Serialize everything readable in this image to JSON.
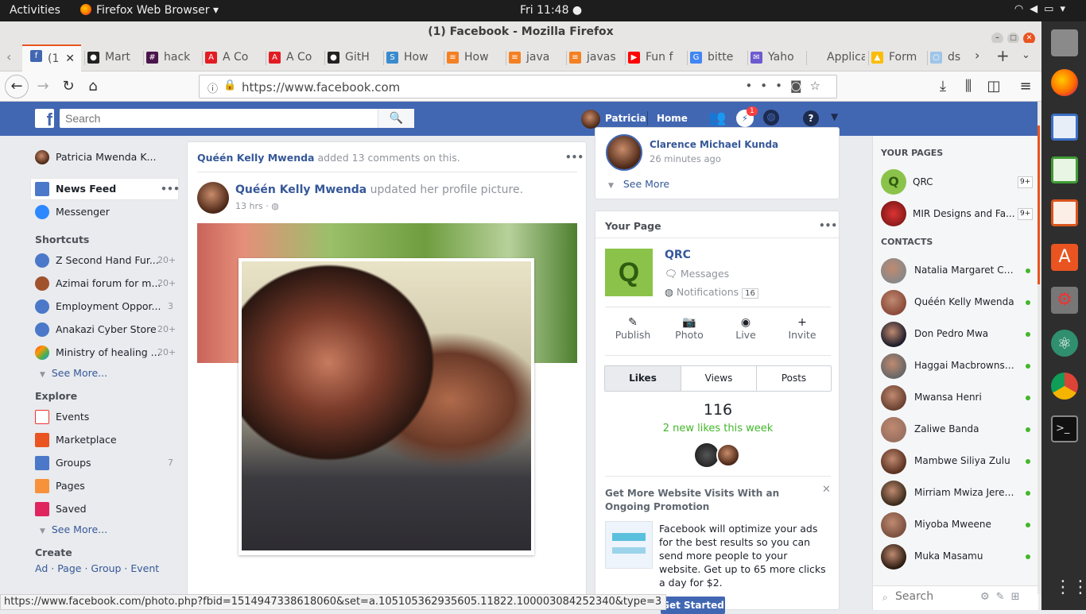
{
  "system": {
    "activities": "Activities",
    "app_name": "Firefox Web Browser",
    "clock": "Fri 11:48"
  },
  "window": {
    "title": "(1) Facebook - Mozilla Firefox"
  },
  "tabs": [
    {
      "label": "(1",
      "icon": "facebook-icon",
      "color": "#4267b2",
      "glyph": "f"
    },
    {
      "label": "Mart",
      "icon": "github-icon",
      "color": "#222222",
      "glyph": "●"
    },
    {
      "label": "hack",
      "icon": "slack-icon",
      "color": "#4a154b",
      "glyph": "#"
    },
    {
      "label": "A Co",
      "icon": "adobe-icon",
      "color": "#e31b23",
      "glyph": "A"
    },
    {
      "label": "A Co",
      "icon": "adobe-icon",
      "color": "#e31b23",
      "glyph": "A"
    },
    {
      "label": "GitH",
      "icon": "github-icon",
      "color": "#222222",
      "glyph": "●"
    },
    {
      "label": "How",
      "icon": "s-icon",
      "color": "#3b8bcc",
      "glyph": "S"
    },
    {
      "label": "How",
      "icon": "stackoverflow-icon",
      "color": "#f48024",
      "glyph": "≡"
    },
    {
      "label": "java",
      "icon": "stackoverflow-icon",
      "color": "#f48024",
      "glyph": "≡"
    },
    {
      "label": "javas",
      "icon": "stackoverflow-icon",
      "color": "#f48024",
      "glyph": "≡"
    },
    {
      "label": "Fun f",
      "icon": "youtube-icon",
      "color": "#ff0000",
      "glyph": "▶"
    },
    {
      "label": "bitte",
      "icon": "google-icon",
      "color": "#4285f4",
      "glyph": "G"
    },
    {
      "label": "Yaho",
      "icon": "mail-icon",
      "color": "#6d5bd0",
      "glyph": "✉"
    },
    {
      "label": "Applicat",
      "icon": "",
      "color": "",
      "glyph": ""
    },
    {
      "label": "Form",
      "icon": "drive-icon",
      "color": "#fbbc04",
      "glyph": "▲"
    },
    {
      "label": "ds",
      "icon": "bulb-icon",
      "color": "#9fc5e8",
      "glyph": "○"
    }
  ],
  "url": "https://www.facebook.com",
  "fb": {
    "search_placeholder": "Search",
    "user_first": "Patricia",
    "home": "Home",
    "msg_badge": "1"
  },
  "left": {
    "profile": "Patricia Mwenda K...",
    "news_feed": "News Feed",
    "messenger": "Messenger",
    "shortcuts_title": "Shortcuts",
    "shortcuts": [
      {
        "label": "Z Second Hand Fur...",
        "count": "20+"
      },
      {
        "label": "Azimai forum for m...",
        "count": "20+"
      },
      {
        "label": "Employment Oppor...",
        "count": "3"
      },
      {
        "label": "Anakazi Cyber Store",
        "count": "20+"
      },
      {
        "label": "Ministry of healing ...",
        "count": "20+"
      }
    ],
    "see_more": "See More...",
    "explore_title": "Explore",
    "explore": [
      {
        "label": "Events",
        "count": ""
      },
      {
        "label": "Marketplace",
        "count": ""
      },
      {
        "label": "Groups",
        "count": "7"
      },
      {
        "label": "Pages",
        "count": ""
      },
      {
        "label": "Saved",
        "count": ""
      }
    ],
    "see_more2": "See More...",
    "create_title": "Create",
    "create_links": [
      "Ad",
      "Page",
      "Group",
      "Event"
    ]
  },
  "feed": {
    "activity_actor": "Quéén Kelly Mwenda",
    "activity_text": "added 13 comments on this.",
    "post_author": "Quéén Kelly Mwenda",
    "post_action": "updated her profile picture.",
    "post_time": "13 hrs"
  },
  "mid": {
    "notif_name": "Clarence Michael Kunda",
    "notif_time": "26 minutes ago",
    "see_more": "See More",
    "your_page_title": "Your Page",
    "page_letter": "Q",
    "page_name": "QRC",
    "messages": "Messages",
    "notifications": "Notifications",
    "notif_count": "16",
    "actions": [
      "Publish",
      "Photo",
      "Live",
      "Invite"
    ],
    "stat_tabs": [
      "Likes",
      "Views",
      "Posts"
    ],
    "likes_count": "116",
    "likes_note": "2 new likes this week",
    "promo_title": "Get More Website Visits With an Ongoing Promotion",
    "promo_text": "Facebook will optimize your ads for the best results so you can send more people to your website. Get up to 65 more clicks a day for $2.",
    "promo_button": "Get Started"
  },
  "right": {
    "your_pages_title": "YOUR PAGES",
    "pages": [
      {
        "name": "QRC",
        "badge": "9+"
      },
      {
        "name": "MIR Designs and Fa...",
        "badge": "9+"
      }
    ],
    "contacts_title": "CONTACTS",
    "contacts": [
      "Natalia Margaret Chi...",
      "Quéén Kelly Mwenda",
      "Don Pedro Mwa",
      "Haggai Macbrowns ...",
      "Mwansa Henri",
      "Zaliwe Banda",
      "Mambwe Siliya Zulu",
      "Mirriam Mwiza Jere ...",
      "Miyoba Mweene",
      "Muka Masamu"
    ],
    "chat_search": "Search"
  },
  "status_url": "https://www.facebook.com/photo.php?fbid=1514947338618060&set=a.105105362935605.11822.100003084252340&type=3",
  "colors": {
    "fb_blue": "#4267b2",
    "link": "#365899",
    "page_green": "#8bc34a",
    "online": "#42b72a"
  }
}
